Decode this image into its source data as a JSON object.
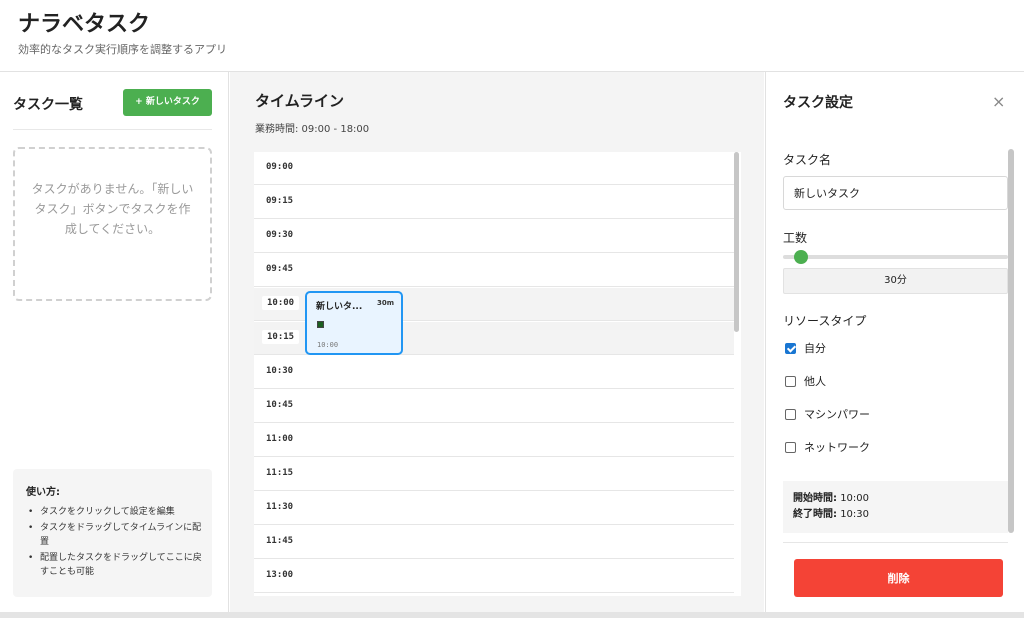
{
  "header": {
    "title": "ナラベタスク",
    "subtitle": "効率的なタスク実行順序を調整するアプリ"
  },
  "task_list": {
    "title": "タスク一覧",
    "new_task_label": "+ 新しいタスク",
    "empty_message": "タスクがありません。「新しいタスク」ボタンでタスクを作成してください。",
    "howto_title": "使い方:",
    "howto_items": [
      "タスクをクリックして設定を編集",
      "タスクをドラッグしてタイムラインに配置",
      "配置したタスクをドラッグしてここに戻すことも可能"
    ]
  },
  "timeline": {
    "title": "タイムライン",
    "business_hours": "業務時間: 09:00 - 18:00",
    "slots": [
      "09:00",
      "09:15",
      "09:30",
      "09:45",
      "10:00",
      "10:15",
      "10:30",
      "10:45",
      "11:00",
      "11:15",
      "11:30",
      "11:45",
      "13:00"
    ],
    "occupied_slots": [
      4,
      5
    ],
    "task_card": {
      "name": "新しいタ...",
      "duration": "30m",
      "start_time": "10:00",
      "slot_index": 4
    }
  },
  "settings": {
    "title": "タスク設定",
    "close_symbol": "×",
    "name_label": "タスク名",
    "name_value": "新しいタスク",
    "effort_label": "工数",
    "effort_value": "30分",
    "effort_fraction": 0.05,
    "resource_label": "リソースタイプ",
    "resources": [
      {
        "label": "自分",
        "checked": true
      },
      {
        "label": "他人",
        "checked": false
      },
      {
        "label": "マシンパワー",
        "checked": false
      },
      {
        "label": "ネットワーク",
        "checked": false
      }
    ],
    "start_label": "開始時間:",
    "start_value": "10:00",
    "end_label": "終了時間:",
    "end_value": "10:30",
    "delete_label": "削除"
  },
  "colors": {
    "primary_green": "#4caf50",
    "task_blue": "#2196f3",
    "delete_red": "#f44336",
    "checkbox_blue": "#1976d2"
  }
}
